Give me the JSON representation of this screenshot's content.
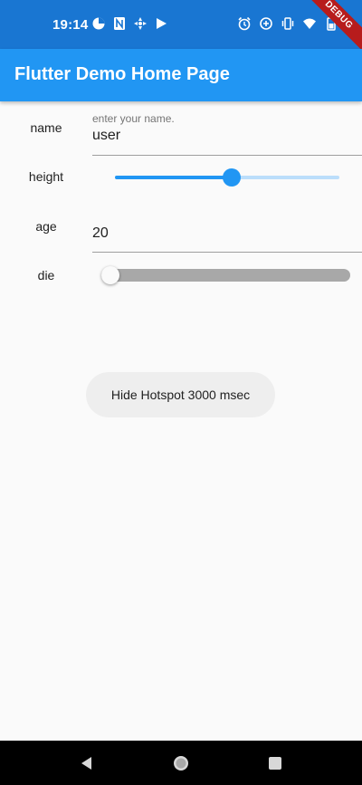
{
  "status_bar": {
    "time": "19:14",
    "left_icons": [
      "data-saver-icon",
      "n-notification-icon",
      "settings-fan-icon",
      "play-store-icon"
    ],
    "right_icons": [
      "alarm-icon",
      "data-saver-circle-icon",
      "vibrate-icon",
      "wifi-icon",
      "battery-icon"
    ]
  },
  "debug_banner": "DEBUG",
  "app_bar": {
    "title": "Flutter Demo Home Page"
  },
  "form": {
    "name": {
      "label": "name",
      "hint": "enter your name.",
      "value": "user"
    },
    "height": {
      "label": "height",
      "value_fraction": 0.52
    },
    "age": {
      "label": "age",
      "value": "20"
    },
    "die": {
      "label": "die",
      "checked": false
    }
  },
  "hide_button": {
    "label": "Hide Hotspot 3000 msec"
  },
  "nav_bar": {
    "buttons": [
      "back-icon",
      "home-icon",
      "recents-icon"
    ]
  },
  "colors": {
    "status_bar": "#1976d2",
    "app_bar": "#2196f3",
    "accent": "#2196f3",
    "track_inactive": "#bbdefb",
    "background": "#fafafa"
  }
}
